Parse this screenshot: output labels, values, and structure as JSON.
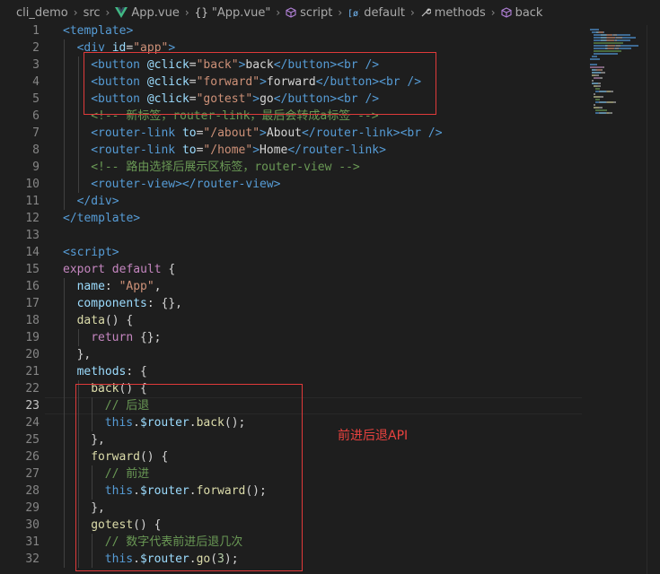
{
  "breadcrumb": {
    "items": [
      {
        "label": "cli_demo",
        "icon": "none"
      },
      {
        "label": "src",
        "icon": "none"
      },
      {
        "label": "App.vue",
        "icon": "vue-icon"
      },
      {
        "label": "\"App.vue\"",
        "icon": "braces-icon"
      },
      {
        "label": "script",
        "icon": "cube-icon"
      },
      {
        "label": "default",
        "icon": "object-icon"
      },
      {
        "label": "methods",
        "icon": "wrench-icon"
      },
      {
        "label": "back",
        "icon": "cube-icon"
      }
    ]
  },
  "editor": {
    "active_line": 23,
    "lines": [
      {
        "n": "1",
        "indent": 0,
        "tokens": [
          [
            "tag",
            "<template>"
          ]
        ]
      },
      {
        "n": "2",
        "indent": 1,
        "tokens": [
          [
            "tag",
            "<div "
          ],
          [
            "attr",
            "id"
          ],
          [
            "txt",
            "="
          ],
          [
            "str",
            "\"app\""
          ],
          [
            "tag",
            ">"
          ]
        ]
      },
      {
        "n": "3",
        "indent": 2,
        "tokens": [
          [
            "tag",
            "<button "
          ],
          [
            "attr",
            "@click"
          ],
          [
            "txt",
            "="
          ],
          [
            "str",
            "\"back\""
          ],
          [
            "tag",
            ">"
          ],
          [
            "txt",
            "back"
          ],
          [
            "tag",
            "</button><br />"
          ]
        ]
      },
      {
        "n": "4",
        "indent": 2,
        "tokens": [
          [
            "tag",
            "<button "
          ],
          [
            "attr",
            "@click"
          ],
          [
            "txt",
            "="
          ],
          [
            "str",
            "\"forward\""
          ],
          [
            "tag",
            ">"
          ],
          [
            "txt",
            "forward"
          ],
          [
            "tag",
            "</button><br />"
          ]
        ]
      },
      {
        "n": "5",
        "indent": 2,
        "tokens": [
          [
            "tag",
            "<button "
          ],
          [
            "attr",
            "@click"
          ],
          [
            "txt",
            "="
          ],
          [
            "str",
            "\"gotest\""
          ],
          [
            "tag",
            ">"
          ],
          [
            "txt",
            "go"
          ],
          [
            "tag",
            "</button><br />"
          ]
        ]
      },
      {
        "n": "6",
        "indent": 2,
        "tokens": [
          [
            "cmt",
            "<!-- 新标签，router-link，最后会转成a标签 -->"
          ]
        ]
      },
      {
        "n": "7",
        "indent": 2,
        "tokens": [
          [
            "tag",
            "<router-link "
          ],
          [
            "attr",
            "to"
          ],
          [
            "txt",
            "="
          ],
          [
            "str",
            "\"/about\""
          ],
          [
            "tag",
            ">"
          ],
          [
            "txt",
            "About"
          ],
          [
            "tag",
            "</router-link><br />"
          ]
        ]
      },
      {
        "n": "8",
        "indent": 2,
        "tokens": [
          [
            "tag",
            "<router-link "
          ],
          [
            "attr",
            "to"
          ],
          [
            "txt",
            "="
          ],
          [
            "str",
            "\"/home\""
          ],
          [
            "tag",
            ">"
          ],
          [
            "txt",
            "Home"
          ],
          [
            "tag",
            "</router-link>"
          ]
        ]
      },
      {
        "n": "9",
        "indent": 2,
        "tokens": [
          [
            "cmt",
            "<!-- 路由选择后展示区标签，router-view -->"
          ]
        ]
      },
      {
        "n": "10",
        "indent": 2,
        "tokens": [
          [
            "tag",
            "<router-view></router-view>"
          ]
        ]
      },
      {
        "n": "11",
        "indent": 1,
        "tokens": [
          [
            "tag",
            "</div>"
          ]
        ]
      },
      {
        "n": "12",
        "indent": 0,
        "tokens": [
          [
            "tag",
            "</template>"
          ]
        ]
      },
      {
        "n": "13",
        "indent": 0,
        "tokens": []
      },
      {
        "n": "14",
        "indent": 0,
        "tokens": [
          [
            "tag",
            "<script>"
          ]
        ]
      },
      {
        "n": "15",
        "indent": 0,
        "tokens": [
          [
            "kw",
            "export "
          ],
          [
            "kw",
            "default "
          ],
          [
            "txt",
            "{"
          ]
        ]
      },
      {
        "n": "16",
        "indent": 1,
        "tokens": [
          [
            "prop",
            "name"
          ],
          [
            "txt",
            ": "
          ],
          [
            "str",
            "\"App\""
          ],
          [
            "txt",
            ","
          ]
        ]
      },
      {
        "n": "17",
        "indent": 1,
        "tokens": [
          [
            "prop",
            "components"
          ],
          [
            "txt",
            ": {},"
          ]
        ]
      },
      {
        "n": "18",
        "indent": 1,
        "tokens": [
          [
            "fn",
            "data"
          ],
          [
            "txt",
            "() {"
          ]
        ]
      },
      {
        "n": "19",
        "indent": 2,
        "tokens": [
          [
            "kw",
            "return "
          ],
          [
            "txt",
            "{};"
          ]
        ]
      },
      {
        "n": "20",
        "indent": 1,
        "tokens": [
          [
            "txt",
            "},"
          ]
        ]
      },
      {
        "n": "21",
        "indent": 1,
        "tokens": [
          [
            "prop",
            "methods"
          ],
          [
            "txt",
            ": {"
          ]
        ]
      },
      {
        "n": "22",
        "indent": 2,
        "tokens": [
          [
            "fn",
            "back"
          ],
          [
            "txt",
            "() {"
          ]
        ]
      },
      {
        "n": "23",
        "indent": 3,
        "tokens": [
          [
            "cmt",
            "// 后退"
          ]
        ]
      },
      {
        "n": "24",
        "indent": 3,
        "tokens": [
          [
            "kw2",
            "this"
          ],
          [
            "txt",
            "."
          ],
          [
            "prop",
            "$router"
          ],
          [
            "txt",
            "."
          ],
          [
            "fn",
            "back"
          ],
          [
            "txt",
            "();"
          ]
        ]
      },
      {
        "n": "25",
        "indent": 2,
        "tokens": [
          [
            "txt",
            "},"
          ]
        ]
      },
      {
        "n": "26",
        "indent": 2,
        "tokens": [
          [
            "fn",
            "forward"
          ],
          [
            "txt",
            "() {"
          ]
        ]
      },
      {
        "n": "27",
        "indent": 3,
        "tokens": [
          [
            "cmt",
            "// 前进"
          ]
        ]
      },
      {
        "n": "28",
        "indent": 3,
        "tokens": [
          [
            "kw2",
            "this"
          ],
          [
            "txt",
            "."
          ],
          [
            "prop",
            "$router"
          ],
          [
            "txt",
            "."
          ],
          [
            "fn",
            "forward"
          ],
          [
            "txt",
            "();"
          ]
        ]
      },
      {
        "n": "29",
        "indent": 2,
        "tokens": [
          [
            "txt",
            "},"
          ]
        ]
      },
      {
        "n": "30",
        "indent": 2,
        "tokens": [
          [
            "fn",
            "gotest"
          ],
          [
            "txt",
            "() {"
          ]
        ]
      },
      {
        "n": "31",
        "indent": 3,
        "tokens": [
          [
            "cmt",
            "// 数字代表前进后退几次"
          ]
        ]
      },
      {
        "n": "32",
        "indent": 3,
        "tokens": [
          [
            "kw2",
            "this"
          ],
          [
            "txt",
            "."
          ],
          [
            "prop",
            "$router"
          ],
          [
            "txt",
            "."
          ],
          [
            "fn",
            "go"
          ],
          [
            "txt",
            "("
          ],
          [
            "num",
            "3"
          ],
          [
            "txt",
            ");"
          ]
        ]
      }
    ]
  },
  "annotation": {
    "label": "前进后退API",
    "color": "#e03a3a"
  },
  "colors": {
    "background": "#1e1e1e",
    "tag": "#569cd6",
    "attr": "#9cdcfe",
    "string": "#ce9178",
    "comment": "#6a9955",
    "keyword": "#c586c0",
    "function": "#dcdcaa"
  }
}
